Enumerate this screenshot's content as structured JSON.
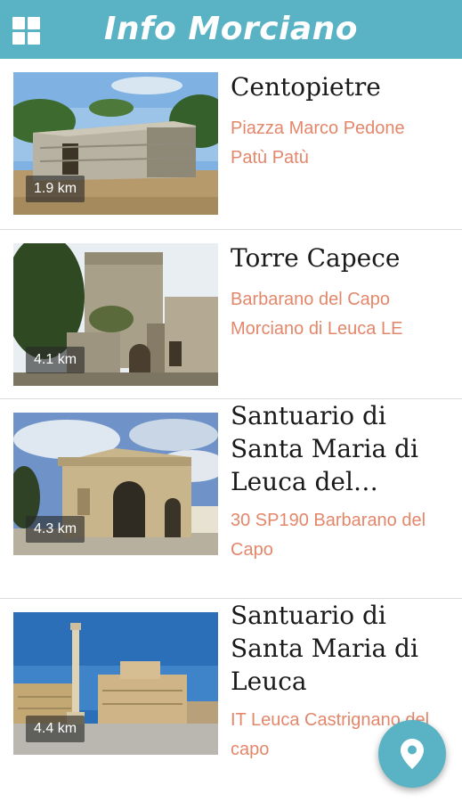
{
  "app": {
    "title": "Info Morciano"
  },
  "places": [
    {
      "name": "Centopietre",
      "address_line1": "Piazza Marco Pedone",
      "address_line2": "Patù Patù",
      "distance": "1.9 km"
    },
    {
      "name": "Torre Capece",
      "address_line1": "Barbarano del Capo",
      "address_line2": "Morciano di Leuca LE",
      "distance": "4.1 km"
    },
    {
      "name": "Santuario di Santa Maria di Leuca del…",
      "name_line1": "Santuario di",
      "name_line2": "Santa Maria di",
      "name_line3": "Leuca del…",
      "address_line1": "30 SP190 Barbarano del",
      "address_line2": "Capo",
      "distance": "4.3 km"
    },
    {
      "name": "Santuario di Santa Maria di Leuca",
      "name_line1": "Santuario di",
      "name_line2": "Santa Maria di",
      "name_line3": "Leuca",
      "address_line1": "IT Leuca Castrignano del",
      "address_line2": "capo",
      "distance": "4.4 km"
    }
  ],
  "icons": {
    "menu": "grid-menu-icon",
    "fab": "map-pin-icon"
  },
  "colors": {
    "primary": "#5ab3c4",
    "address": "#e3876b",
    "title_text": "#1a1a1a"
  }
}
